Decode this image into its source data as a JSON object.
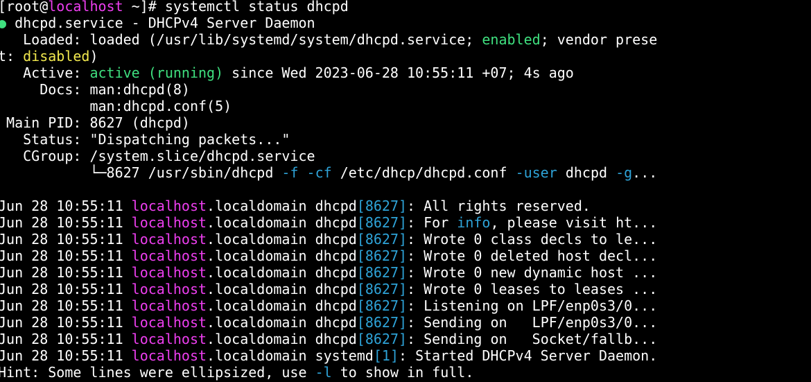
{
  "colors": {
    "background": "#000000",
    "default_text": "#ffffff",
    "green": "#3fe07f",
    "yellow": "#f2e94e",
    "magenta": "#ee3ef0",
    "blue": "#2ea3d8"
  },
  "lines": [
    [
      {
        "text": "[root@",
        "color": "white"
      },
      {
        "text": "localhost",
        "color": "magenta"
      },
      {
        "text": " ~]# systemctl status dhcpd",
        "color": "white"
      }
    ],
    [
      {
        "text": "●",
        "color": "dot"
      },
      {
        "text": " dhcpd.service - DHCPv4 Server Daemon",
        "color": "white"
      }
    ],
    [
      {
        "text": "   Loaded: loaded (/usr/lib/systemd/system/dhcpd.service; ",
        "color": "white"
      },
      {
        "text": "enabled",
        "color": "green"
      },
      {
        "text": "; vendor prese",
        "color": "white"
      }
    ],
    [
      {
        "text": "t: ",
        "color": "white"
      },
      {
        "text": "disabled",
        "color": "yellow"
      },
      {
        "text": ")",
        "color": "white"
      }
    ],
    [
      {
        "text": "   Active: ",
        "color": "white"
      },
      {
        "text": "active (running)",
        "color": "green"
      },
      {
        "text": " since Wed 2023-06-28 10:55:11 +07; 4s ago",
        "color": "white"
      }
    ],
    [
      {
        "text": "     Docs: man:dhcpd(8)",
        "color": "white"
      }
    ],
    [
      {
        "text": "           man:dhcpd.conf(5)",
        "color": "white"
      }
    ],
    [
      {
        "text": " Main PID: 8627 (dhcpd)",
        "color": "white"
      }
    ],
    [
      {
        "text": "   Status: \"Dispatching packets...\"",
        "color": "white"
      }
    ],
    [
      {
        "text": "   CGroup: /system.slice/dhcpd.service",
        "color": "white"
      }
    ],
    [
      {
        "text": "           └─8627 /usr/sbin/dhcpd ",
        "color": "white"
      },
      {
        "text": "-f -cf",
        "color": "blue"
      },
      {
        "text": " /etc/dhcp/dhcpd.conf ",
        "color": "white"
      },
      {
        "text": "-user",
        "color": "blue"
      },
      {
        "text": " dhcpd ",
        "color": "white"
      },
      {
        "text": "-g",
        "color": "blue"
      },
      {
        "text": "...",
        "color": "white"
      }
    ],
    [],
    [
      {
        "text": "Jun 28 10:55:11 ",
        "color": "white"
      },
      {
        "text": "localhost",
        "color": "magenta"
      },
      {
        "text": ".localdomain dhcpd",
        "color": "white"
      },
      {
        "text": "[8627]",
        "color": "blue"
      },
      {
        "text": ": All rights reserved.",
        "color": "white"
      }
    ],
    [
      {
        "text": "Jun 28 10:55:11 ",
        "color": "white"
      },
      {
        "text": "localhost",
        "color": "magenta"
      },
      {
        "text": ".localdomain dhcpd",
        "color": "white"
      },
      {
        "text": "[8627]",
        "color": "blue"
      },
      {
        "text": ": For ",
        "color": "white"
      },
      {
        "text": "info",
        "color": "blue"
      },
      {
        "text": ", please visit ht...",
        "color": "white"
      }
    ],
    [
      {
        "text": "Jun 28 10:55:11 ",
        "color": "white"
      },
      {
        "text": "localhost",
        "color": "magenta"
      },
      {
        "text": ".localdomain dhcpd",
        "color": "white"
      },
      {
        "text": "[8627]",
        "color": "blue"
      },
      {
        "text": ": Wrote 0 class decls to le...",
        "color": "white"
      }
    ],
    [
      {
        "text": "Jun 28 10:55:11 ",
        "color": "white"
      },
      {
        "text": "localhost",
        "color": "magenta"
      },
      {
        "text": ".localdomain dhcpd",
        "color": "white"
      },
      {
        "text": "[8627]",
        "color": "blue"
      },
      {
        "text": ": Wrote 0 deleted host decl...",
        "color": "white"
      }
    ],
    [
      {
        "text": "Jun 28 10:55:11 ",
        "color": "white"
      },
      {
        "text": "localhost",
        "color": "magenta"
      },
      {
        "text": ".localdomain dhcpd",
        "color": "white"
      },
      {
        "text": "[8627]",
        "color": "blue"
      },
      {
        "text": ": Wrote 0 new dynamic host ...",
        "color": "white"
      }
    ],
    [
      {
        "text": "Jun 28 10:55:11 ",
        "color": "white"
      },
      {
        "text": "localhost",
        "color": "magenta"
      },
      {
        "text": ".localdomain dhcpd",
        "color": "white"
      },
      {
        "text": "[8627]",
        "color": "blue"
      },
      {
        "text": ": Wrote 0 leases to leases ...",
        "color": "white"
      }
    ],
    [
      {
        "text": "Jun 28 10:55:11 ",
        "color": "white"
      },
      {
        "text": "localhost",
        "color": "magenta"
      },
      {
        "text": ".localdomain dhcpd",
        "color": "white"
      },
      {
        "text": "[8627]",
        "color": "blue"
      },
      {
        "text": ": Listening on LPF/enp0s3/0...",
        "color": "white"
      }
    ],
    [
      {
        "text": "Jun 28 10:55:11 ",
        "color": "white"
      },
      {
        "text": "localhost",
        "color": "magenta"
      },
      {
        "text": ".localdomain dhcpd",
        "color": "white"
      },
      {
        "text": "[8627]",
        "color": "blue"
      },
      {
        "text": ": Sending on   LPF/enp0s3/0...",
        "color": "white"
      }
    ],
    [
      {
        "text": "Jun 28 10:55:11 ",
        "color": "white"
      },
      {
        "text": "localhost",
        "color": "magenta"
      },
      {
        "text": ".localdomain dhcpd",
        "color": "white"
      },
      {
        "text": "[8627]",
        "color": "blue"
      },
      {
        "text": ": Sending on   Socket/fallb...",
        "color": "white"
      }
    ],
    [
      {
        "text": "Jun 28 10:55:11 ",
        "color": "white"
      },
      {
        "text": "localhost",
        "color": "magenta"
      },
      {
        "text": ".localdomain systemd",
        "color": "white"
      },
      {
        "text": "[1]",
        "color": "blue"
      },
      {
        "text": ": Started DHCPv4 Server Daemon.",
        "color": "white"
      }
    ],
    [
      {
        "text": "Hint: Some lines were ellipsized, use ",
        "color": "white"
      },
      {
        "text": "-l",
        "color": "blue"
      },
      {
        "text": " to show in full.",
        "color": "white"
      }
    ]
  ]
}
